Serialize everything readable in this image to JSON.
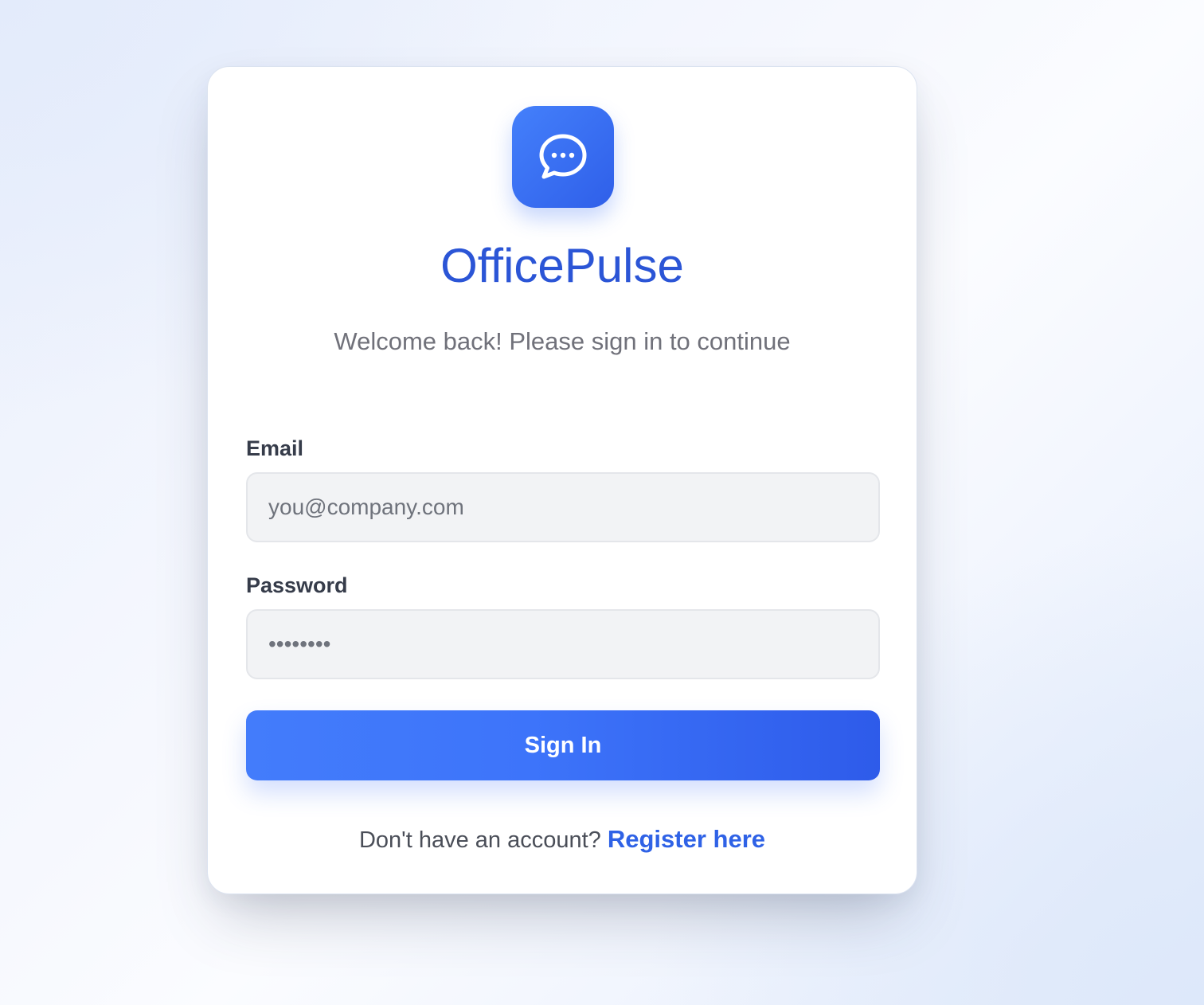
{
  "app": {
    "name": "OfficePulse",
    "subtitle": "Welcome back! Please sign in to continue",
    "logo_icon": "chat-bubble-icon",
    "accent_color": "#3b6ef5"
  },
  "form": {
    "email_label": "Email",
    "email_placeholder": "you@company.com",
    "email_value": "",
    "password_label": "Password",
    "password_placeholder": "••••••••",
    "password_value": "",
    "submit_label": "Sign In"
  },
  "footer": {
    "prompt": "Don't have an account?",
    "register_label": "Register here"
  }
}
